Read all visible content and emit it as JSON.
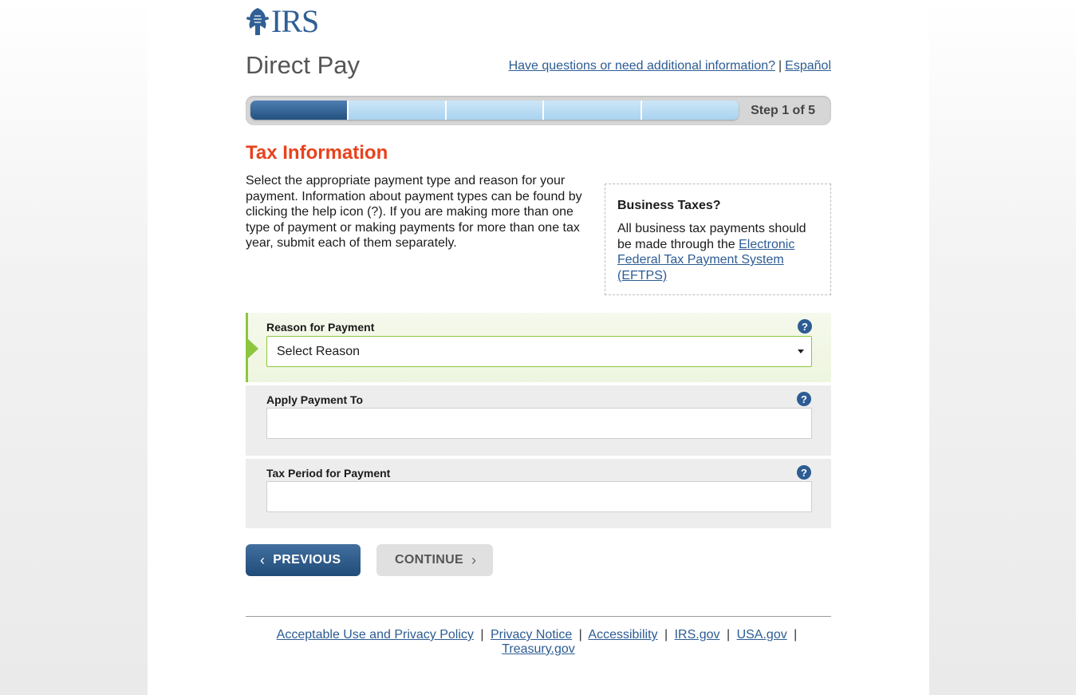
{
  "brand": {
    "logo_text": "IRS",
    "accent": "#2c5c93",
    "title_color": "#e8421d"
  },
  "header": {
    "app_title": "Direct Pay",
    "help_link": "Have questions or need additional information?",
    "separator": "|",
    "spanish_link": "Español"
  },
  "progress": {
    "total_steps": 5,
    "current_step": 1,
    "label": "Step 1 of 5"
  },
  "main": {
    "section_title": "Tax Information",
    "intro": "Select the appropriate payment type and reason for your payment. Information about payment types can be found by clicking the help icon (?). If you are making more than one type of payment or making payments for more than one tax year, submit each of them separately."
  },
  "sidebox": {
    "title": "Business Taxes?",
    "text": "All business tax payments should be made through the ",
    "link": "Electronic Federal Tax Payment System (EFTPS)"
  },
  "form": {
    "reason": {
      "label": "Reason for Payment",
      "value": "Select Reason",
      "help": "?"
    },
    "apply_to": {
      "label": "Apply Payment To",
      "value": "",
      "help": "?"
    },
    "tax_period": {
      "label": "Tax Period for Payment",
      "value": "",
      "help": "?"
    }
  },
  "buttons": {
    "previous": "PREVIOUS",
    "continue": "CONTINUE",
    "prev_glyph": "‹",
    "next_glyph": "›"
  },
  "footer": {
    "links": [
      "Acceptable Use and Privacy Policy",
      "Privacy Notice",
      "Accessibility",
      "IRS.gov",
      "USA.gov",
      "Treasury.gov"
    ],
    "separator": "|"
  }
}
